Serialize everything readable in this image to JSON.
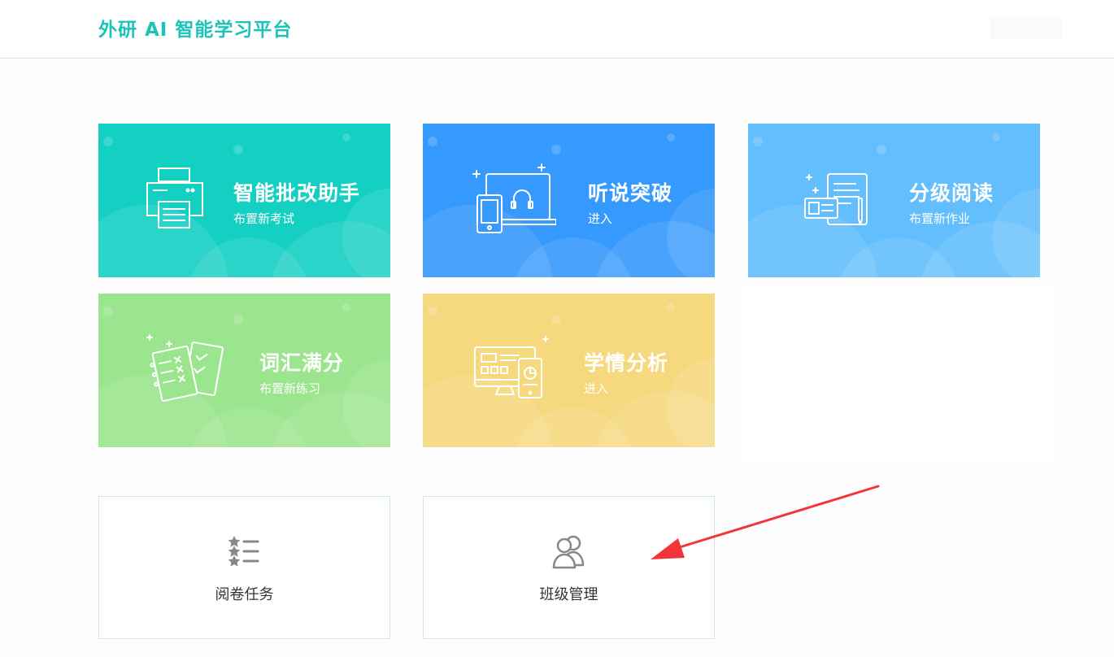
{
  "header": {
    "brand": "外研 AI 智能学习平台"
  },
  "cards": [
    {
      "title": "智能批改助手",
      "sub": "布置新考试",
      "icon": "printer-icon",
      "color": "#13d0c2"
    },
    {
      "title": "听说突破",
      "sub": "进入",
      "icon": "devices-headphone-icon",
      "color": "#3599fd"
    },
    {
      "title": "分级阅读",
      "sub": "布置新作业",
      "icon": "reading-doc-icon",
      "color": "#62befc"
    },
    {
      "title": "词汇满分",
      "sub": "布置新练习",
      "icon": "worksheet-icon",
      "color": "#9be58e"
    },
    {
      "title": "学情分析",
      "sub": "进入",
      "icon": "analytics-devices-icon",
      "color": "#f6d87f"
    }
  ],
  "tiles": [
    {
      "label": "阅卷任务",
      "icon": "star-list-icon"
    },
    {
      "label": "班级管理",
      "icon": "users-icon"
    }
  ],
  "annotation": {
    "arrow_color": "#f2353a",
    "target": "班级管理"
  }
}
